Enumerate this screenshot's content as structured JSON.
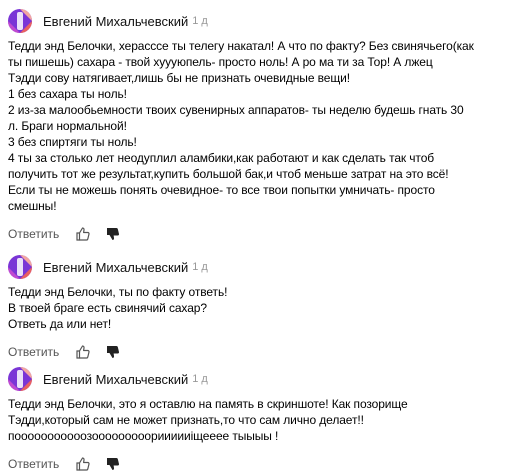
{
  "comments": [
    {
      "author": "Евгений Михальчевский",
      "age": "1 д",
      "text": "Тедди энд Белочки, херасссе ты телегу накатал! А что по факту? Без свинячьего(как\nты пишешь) сахара - твой хуууюпель- просто ноль! А ро ма ти за Тор! А лжец\nТэдди сову натягивает,лишь бы не признать очевидные вещи!\n1 без сахара ты ноль!\n2 из-за малообьемности твоих сувенирных аппаратов- ты неделю будешь гнать 30\nл. Браги нормальной!\n3 без спиртяги ты ноль!\n4 ты за столько лет неодуплил аламбики,как работают и как сделать так чтоб\nполучить тот же результат,купить большой бак,и чтоб меньше затрат на это всё!\nЕсли ты не можешь понять очевидное- то все твои попытки умничать- просто\nсмешны!",
      "reply_label": "Ответить",
      "avatar_colors": [
        "#7a35d6",
        "#e96060",
        "#f2a6a0"
      ]
    },
    {
      "author": "Евгений Михальчевский",
      "age": "1 д",
      "text": "Тедди энд Белочки, ты по факту ответь!\nВ твоей браге есть свинячий сахар?\nОтветь да или нет!",
      "reply_label": "Ответить",
      "avatar_colors": [
        "#7a35d6",
        "#e96060",
        "#f2a6a0"
      ]
    },
    {
      "author": "Евгений Михальчевский",
      "age": "1 д",
      "text": "Тедди энд Белочки, это я оставлю на память в скриншоте! Как позорище\nТэдди,который сам не может признать,то что сам лично делает!!\nпооооооооооозооооооооориииииiщееее тыыыы !",
      "reply_label": "Ответить",
      "avatar_colors": [
        "#7a35d6",
        "#e96060",
        "#f2a6a0"
      ]
    }
  ],
  "icons": {
    "like": "thumbs-up-icon",
    "dislike": "thumbs-down-icon",
    "avatar": "avatar"
  }
}
